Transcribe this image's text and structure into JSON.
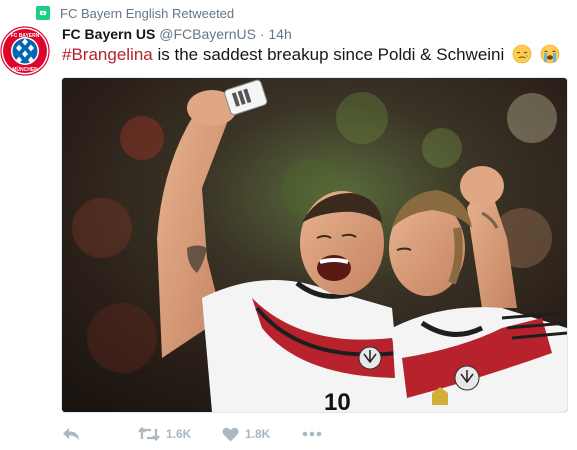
{
  "retweet_context": {
    "text": "FC Bayern English Retweeted",
    "icon": "retweet-icon",
    "color": "#19cf86"
  },
  "author": {
    "name": "FC Bayern US",
    "handle": "@FCBayernUS",
    "separator": "·",
    "time": "14h",
    "avatar_icon": "fc-bayern-logo",
    "avatar_text_top": "FC BAYERN",
    "avatar_text_bottom": "MÜNCHEN"
  },
  "tweet": {
    "hashtag": "#Brangelina",
    "text": " is the saddest breakup since Poldi & Schweini",
    "emojis": [
      "disappointed-relieved-face-icon",
      "loudly-crying-face-icon"
    ]
  },
  "media": {
    "kind": "photo",
    "jersey_number": "10"
  },
  "actions": {
    "reply_icon": "reply-icon",
    "retweet_icon": "retweet-icon",
    "retweet_count": "1.6K",
    "like_icon": "heart-icon",
    "like_count": "1.8K",
    "more_icon": "more-icon"
  },
  "colors": {
    "hashtag": "#b5222c",
    "secondary_text": "#657786",
    "action_gray": "#aab8c2",
    "bayern_red": "#dc052d"
  }
}
